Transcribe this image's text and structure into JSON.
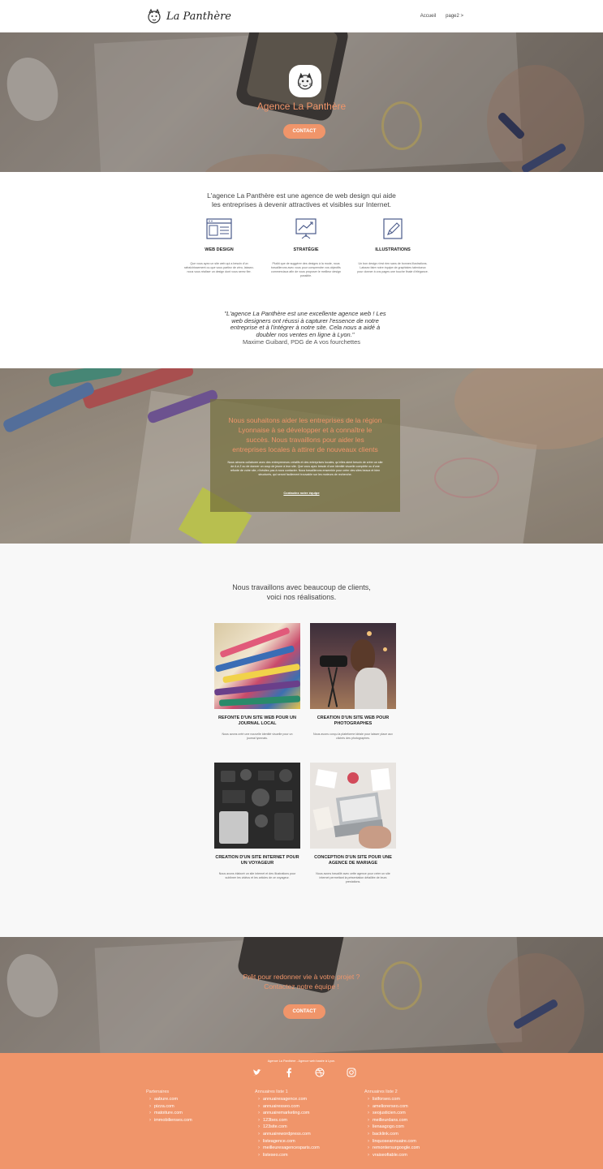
{
  "brand": {
    "name": "La Panthère"
  },
  "nav": {
    "links": [
      "Accueil",
      "page2 >"
    ]
  },
  "hero": {
    "title": "Agence La Panthère",
    "button": "CONTACT"
  },
  "intro": {
    "line1": "L'agence La Panthère est une agence de web design qui aide",
    "line2": "les entreprises à devenir attractives et visibles sur Internet."
  },
  "services": [
    {
      "title": "WEB DESIGN",
      "text": "Que vous ayez un site web qui a besoin d'un rafraîchissement ou que vous partiez de zéro, laissez-nous vous réaliser un design dont vous serez fier.",
      "icon": "browser-window-icon"
    },
    {
      "title": "STRATÉGIE",
      "text": "Plutôt que de suggérer des designs à la mode, nous travaillerons avec vous pour comprendre vos objectifs commerciaux afin de vous proposer le meilleur design possible.",
      "icon": "chart-board-icon"
    },
    {
      "title": "ILLUSTRATIONS",
      "text": "Un bon design n'est rien sans de bonnes illustrations. Laissez faire notre équipe de graphistes talentueux pour donner à vos pages une touche finale d'élégance.",
      "icon": "pencil-icon"
    }
  ],
  "quote": {
    "lines": [
      "\"L'agence La Panthère est une excellente agence web ! Les",
      "web designers ont réussi à capturer l'essence de notre",
      "entreprise et à l'intégrer à notre site. Cela nous a aidé à",
      "doubler nos ventes en ligne à Lyon.\""
    ],
    "author": "Maxime Guibard, PDG de A vos fourchettes"
  },
  "mission": {
    "title_lines": [
      "Nous souhaitons aider les entreprises de la région",
      "Lyonnaise à se développer et à connaître le",
      "succès. Nous travaillons pour aider les",
      "entreprises locales à attirer de nouveaux clients"
    ],
    "text": "Nous aimons collaborer avec des entrepreneurs créatifs et des entreprises locales, qu'elles aient besoin de créer un site de A à Z ou de donner un coup de jeune à leur site. Que vous ayez besoin d'une identité visuelle complète ou d'une refonte de votre site, n'hésitez pas à nous contacter. Nous travaillerons ensemble pour créer des sites beaux et bien structurés, qui seront facilement trouvable sur les moteurs de recherche.",
    "link": "Contactez notre équipe"
  },
  "portfolio": {
    "title_lines": [
      "Nous travaillons avec beaucoup de clients,",
      "voici nos réalisations."
    ],
    "items": [
      {
        "title": "REFONTE D'UN SITE WEB POUR UN JOURNAL LOCAL",
        "text": "Nous avons créé une nouvelle identité visuelle pour un journal lyonnais."
      },
      {
        "title": "CREATION D'UN SITE WEB POUR PHOTOGRAPHES",
        "text": "Nous avons conçu la plateforme idéale pour laisser place aux clichés des photographes."
      },
      {
        "title": "CREATION D'UN SITE INTERNET POUR UN VOYAGEUR",
        "text": "Nous avons élaboré un site internet et des illustrations pour sublimer les vidéos et les articles de ce voyageur."
      },
      {
        "title": "CONCEPTION D'UN SITE POUR UNE AGENCE DE MARIAGE",
        "text": "Nous avons travaillé avec cette agence pour créer un site internet permettant la présentation détaillée de leurs prestations."
      }
    ]
  },
  "cta": {
    "title_lines": [
      "Prêt pour redonner vie à votre projet ?",
      "Contactez notre équipe !"
    ],
    "button": "CONTACT"
  },
  "footer": {
    "tagline": "Agence La Panthère - Agence web basée à Lyon.",
    "social": [
      "twitter-icon",
      "facebook-icon",
      "dribbble-icon",
      "instagram-icon"
    ],
    "columns": [
      {
        "title": "Partenaires",
        "items": [
          "aabure.com",
          "pizza.com",
          "matoiture.com",
          "immobilienses.com"
        ]
      },
      {
        "title": "Annuaires liste 1",
        "items": [
          "annuairesagence.com",
          "annuairesseo.com",
          "annuairemarketing.com",
          "123bes.com",
          "123site.com",
          "annuairewordpress.com",
          "listeagence.com",
          "meilleuresagencesparis.com",
          "listeseo.com"
        ]
      },
      {
        "title": "Annuaires liste 2",
        "items": [
          "listforseo.com",
          "ameliorerseo.com",
          "seojusticien.com",
          "meilleurdans.com",
          "lienaagogo.com",
          "backlink.com",
          "linquoseannuaire.com",
          "remontersurgoogle.com",
          "vraiseofiable.com"
        ]
      }
    ]
  },
  "colors": {
    "accent": "#f0956a"
  }
}
